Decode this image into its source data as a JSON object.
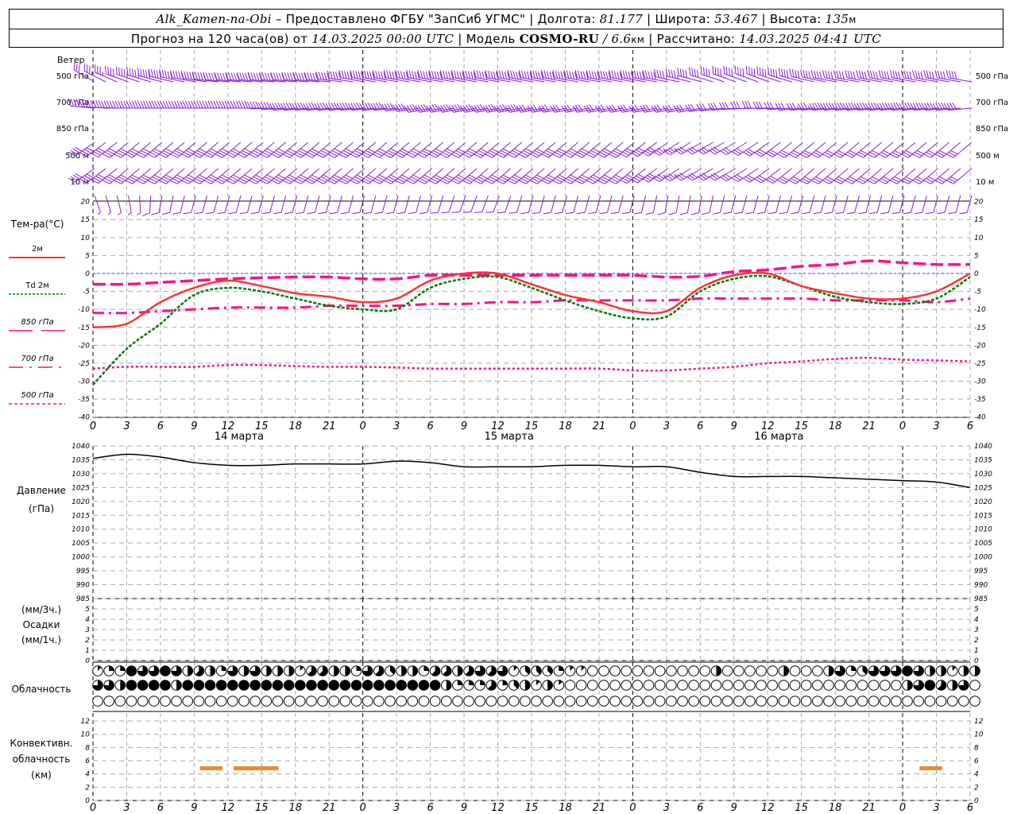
{
  "header": {
    "station": "Alk_Kamen-na-Obi",
    "provider": "– Предоставлено ФГБУ \"ЗапСиб УГМС\"",
    "lon_label": "| Долгота:",
    "lon": "81.177",
    "lat_label": "| Широта:",
    "lat": "53.467",
    "alt_label": "| Высота:",
    "alt": "135",
    "alt_unit": "м",
    "forecast_label": "Прогноз на 120 часа(ов) от",
    "forecast_start": "14.03.2025 00:00 UTC",
    "model_label": "| Модель",
    "model": "COSMO-RU",
    "resolution": "/ 6.6",
    "res_unit": "км",
    "computed_label": "| Рассчитано:",
    "computed": "14.03.2025 04:41 UTC"
  },
  "labels": {
    "wind": "Ветер",
    "wind_levels": [
      "500 гПа",
      "700 гПа",
      "850 гПа",
      "500 м",
      "10 м"
    ],
    "temp_title": "Тем-ра(°C)",
    "temp_legend": [
      "2м",
      "Td  2м",
      "850 гПа",
      "700 гПа",
      "500 гПа"
    ],
    "pressure": [
      "Давление",
      "(гПа)"
    ],
    "precip": [
      "(мм/3ч.)",
      "Осадки",
      "(мм/1ч.)"
    ],
    "clouds": "Облачность",
    "convective": [
      "Конвективн.",
      "облачность",
      "(км)"
    ]
  },
  "colors": {
    "t2m": "#ff3333",
    "td": "#007a00",
    "t850": "#ff0f8a",
    "t700": "#ff0f8a",
    "t500": "#ff0f8a",
    "zero": "#2040ff",
    "wind": "#8a1be0",
    "conv": "#f08a2a",
    "pressure": "#000000"
  },
  "chart_data": {
    "type": "line",
    "hours": [
      0,
      3,
      6,
      9,
      12,
      15,
      18,
      21,
      24,
      27,
      30,
      33,
      36,
      39,
      42,
      45,
      48,
      51,
      54,
      57,
      60,
      63,
      66,
      69,
      72,
      75,
      78
    ],
    "x_tick_labels": [
      "0",
      "3",
      "6",
      "9",
      "12",
      "15",
      "18",
      "21",
      "0",
      "3",
      "6",
      "9",
      "12",
      "15",
      "18",
      "21",
      "0",
      "3",
      "6",
      "9",
      "12",
      "15",
      "18",
      "21",
      "0",
      "3",
      "6"
    ],
    "day_labels": [
      "14 марта",
      "15 марта",
      "16 марта"
    ],
    "temperature": {
      "ylim": [
        -40,
        20
      ],
      "ticks": [
        "20",
        "15",
        "10",
        "5",
        "0",
        "-5",
        "-10",
        "-15",
        "-20",
        "-25",
        "-30",
        "-35",
        "-40"
      ],
      "series": [
        {
          "name": "2м",
          "values": [
            -15,
            -14,
            -8,
            -4,
            -2,
            -3.5,
            -5.5,
            -6.5,
            -8,
            -7,
            -2,
            0,
            0,
            -3,
            -6,
            -8,
            -10.5,
            -10.5,
            -4,
            -0.5,
            0,
            -3.5,
            -5.5,
            -7,
            -7,
            -5,
            0
          ]
        },
        {
          "name": "Td 2м",
          "values": [
            -31,
            -21,
            -14,
            -6,
            -4,
            -5,
            -7,
            -9,
            -10,
            -10,
            -4,
            -1.5,
            -1,
            -4,
            -7.5,
            -10.5,
            -12.5,
            -12,
            -5,
            -1.5,
            -0.8,
            -3.5,
            -6.5,
            -8,
            -8.5,
            -7,
            -1
          ]
        },
        {
          "name": "850 гПа",
          "values": [
            -3,
            -3,
            -2.5,
            -2,
            -1.5,
            -1.2,
            -1,
            -1,
            -1.5,
            -1.5,
            -0.5,
            -0.5,
            -0.5,
            -0.5,
            -0.5,
            -0.5,
            -0.5,
            -1,
            -0.8,
            0.5,
            1,
            2,
            2.5,
            3.5,
            3,
            2.5,
            2.5
          ]
        },
        {
          "name": "700 гПа",
          "values": [
            -11,
            -11,
            -10.5,
            -10,
            -9.5,
            -9.5,
            -9.5,
            -9,
            -9,
            -9,
            -8.5,
            -8.5,
            -8,
            -8,
            -7.5,
            -7.5,
            -7.5,
            -7.5,
            -7,
            -7,
            -7,
            -7,
            -7.5,
            -7.5,
            -7.5,
            -8,
            -7
          ]
        },
        {
          "name": "500 гПа",
          "values": [
            -26.5,
            -26,
            -26,
            -26,
            -25.5,
            -25.5,
            -25.8,
            -26,
            -26,
            -26.2,
            -26.5,
            -26.5,
            -26.5,
            -26.5,
            -26.5,
            -26.5,
            -27,
            -27,
            -26.5,
            -26,
            -25,
            -24.5,
            -23.8,
            -23.5,
            -24,
            -24.2,
            -24.5
          ]
        }
      ]
    },
    "pressure": {
      "ylim": [
        985,
        1040
      ],
      "ticks": [
        "1040",
        "1035",
        "1030",
        "1025",
        "1020",
        "1015",
        "1010",
        "1005",
        "1000",
        "995",
        "990",
        "985"
      ],
      "values": [
        1035.5,
        1037,
        1036,
        1034,
        1033,
        1033,
        1033.5,
        1033.5,
        1033.5,
        1034.5,
        1034,
        1032.5,
        1032.5,
        1032.5,
        1033,
        1033,
        1032.5,
        1032.5,
        1030.5,
        1029,
        1029,
        1029,
        1028.5,
        1028,
        1027.5,
        1027,
        1025
      ]
    },
    "precip": {
      "ylim": [
        0,
        5
      ],
      "ticks": [
        "5",
        "4",
        "3",
        "2",
        "1",
        "0"
      ],
      "values": []
    },
    "clouds_oktas": {
      "high": [
        1,
        2,
        2,
        8,
        6,
        6,
        8,
        6,
        4,
        5,
        4,
        2,
        6,
        4,
        6,
        4,
        4,
        4,
        1,
        5,
        5,
        4,
        4,
        2,
        6,
        5,
        3,
        4,
        4,
        2,
        5,
        5,
        4,
        5,
        6,
        5,
        6,
        1,
        3,
        3,
        3,
        2,
        1,
        1,
        0,
        0,
        0,
        0,
        0,
        0,
        0,
        0,
        0,
        0,
        0,
        4,
        0,
        0,
        0,
        0,
        0,
        4,
        0,
        0,
        0,
        4,
        6,
        2,
        3,
        6,
        6,
        6,
        8,
        6,
        4,
        4,
        1,
        4,
        4
      ],
      "middle": [
        6,
        6,
        4,
        8,
        8,
        8,
        8,
        4,
        8,
        8,
        8,
        8,
        8,
        8,
        8,
        8,
        8,
        8,
        8,
        8,
        8,
        8,
        8,
        8,
        8,
        8,
        8,
        8,
        8,
        8,
        8,
        4,
        2,
        2,
        2,
        5,
        2,
        3,
        4,
        1,
        4,
        1,
        0,
        0,
        0,
        0,
        0,
        0,
        0,
        0,
        0,
        0,
        0,
        0,
        0,
        0,
        0,
        0,
        0,
        0,
        0,
        0,
        0,
        0,
        0,
        0,
        0,
        0,
        0,
        0,
        0,
        0,
        4,
        6,
        8,
        5,
        4,
        6,
        0
      ],
      "low": [
        0,
        0,
        0,
        0,
        0,
        0,
        0,
        0,
        0,
        0,
        0,
        0,
        0,
        0,
        0,
        0,
        0,
        0,
        0,
        0,
        0,
        0,
        0,
        0,
        0,
        0,
        0,
        0,
        0,
        0,
        0,
        0,
        0,
        0,
        0,
        0,
        0,
        0,
        0,
        0,
        0,
        0,
        0,
        0,
        0,
        0,
        0,
        0,
        0,
        0,
        0,
        0,
        0,
        0,
        0,
        0,
        0,
        0,
        0,
        0,
        0,
        0,
        0,
        0,
        0,
        0,
        0,
        0,
        0,
        0,
        0,
        0,
        0,
        0,
        0,
        0,
        0,
        0,
        0
      ]
    },
    "convective": {
      "ylim": [
        0,
        12
      ],
      "ticks": [
        "12",
        "10",
        "8",
        "6",
        "4",
        "2",
        "0"
      ],
      "bars": [
        {
          "start_h": 9.5,
          "end_h": 11.5,
          "top_km": 4.8
        },
        {
          "start_h": 12.5,
          "end_h": 16.5,
          "top_km": 4.8
        },
        {
          "start_h": 73.5,
          "end_h": 75.5,
          "top_km": 4.8
        }
      ]
    },
    "wind": {
      "levels": [
        "500 гПа",
        "700 гПа",
        "850 гПа",
        "500 м",
        "10 м"
      ],
      "direction_deg": [
        [
          300,
          290,
          285,
          280,
          275,
          275,
          275,
          275,
          280,
          280,
          280,
          280,
          280,
          280,
          280,
          280,
          280,
          280,
          285,
          290,
          290,
          285,
          280,
          280,
          280,
          280,
          280
        ],
        [
          275,
          270,
          270,
          270,
          270,
          270,
          265,
          265,
          265,
          265,
          260,
          260,
          260,
          260,
          260,
          260,
          260,
          260,
          260,
          265,
          270,
          265,
          265,
          265,
          265,
          265,
          265
        ],
        [
          235,
          230,
          230,
          230,
          230,
          230,
          230,
          230,
          230,
          230,
          230,
          230,
          230,
          230,
          230,
          230,
          230,
          235,
          240,
          240,
          235,
          230,
          230,
          230,
          230,
          230,
          230
        ],
        [
          235,
          230,
          230,
          230,
          230,
          230,
          230,
          230,
          230,
          230,
          230,
          230,
          230,
          230,
          230,
          230,
          230,
          235,
          240,
          240,
          235,
          230,
          230,
          230,
          230,
          230,
          230
        ],
        [
          160,
          170,
          190,
          195,
          195,
          195,
          195,
          195,
          195,
          195,
          195,
          200,
          200,
          195,
          195,
          195,
          195,
          190,
          190,
          195,
          195,
          195,
          195,
          195,
          195,
          195,
          195
        ]
      ],
      "speed_ms": [
        [
          15,
          20,
          25,
          25,
          25,
          25,
          25,
          25,
          25,
          25,
          25,
          25,
          25,
          25,
          25,
          25,
          25,
          25,
          20,
          20,
          20,
          20,
          20,
          20,
          20,
          20,
          20
        ],
        [
          20,
          20,
          20,
          20,
          20,
          20,
          20,
          20,
          20,
          20,
          20,
          20,
          20,
          20,
          15,
          15,
          15,
          15,
          15,
          15,
          15,
          15,
          20,
          20,
          20,
          20,
          20
        ],
        [
          20,
          20,
          20,
          20,
          20,
          20,
          20,
          20,
          20,
          20,
          20,
          20,
          20,
          20,
          20,
          20,
          20,
          20,
          15,
          15,
          15,
          15,
          15,
          15,
          15,
          15,
          15
        ],
        [
          20,
          20,
          20,
          20,
          20,
          20,
          20,
          20,
          20,
          20,
          20,
          20,
          20,
          20,
          20,
          20,
          20,
          20,
          15,
          15,
          15,
          15,
          15,
          15,
          15,
          15,
          15
        ],
        [
          3,
          3,
          5,
          5,
          5,
          5,
          5,
          5,
          5,
          5,
          5,
          5,
          5,
          5,
          5,
          5,
          5,
          5,
          5,
          5,
          5,
          5,
          5,
          5,
          5,
          5,
          5
        ]
      ]
    }
  }
}
